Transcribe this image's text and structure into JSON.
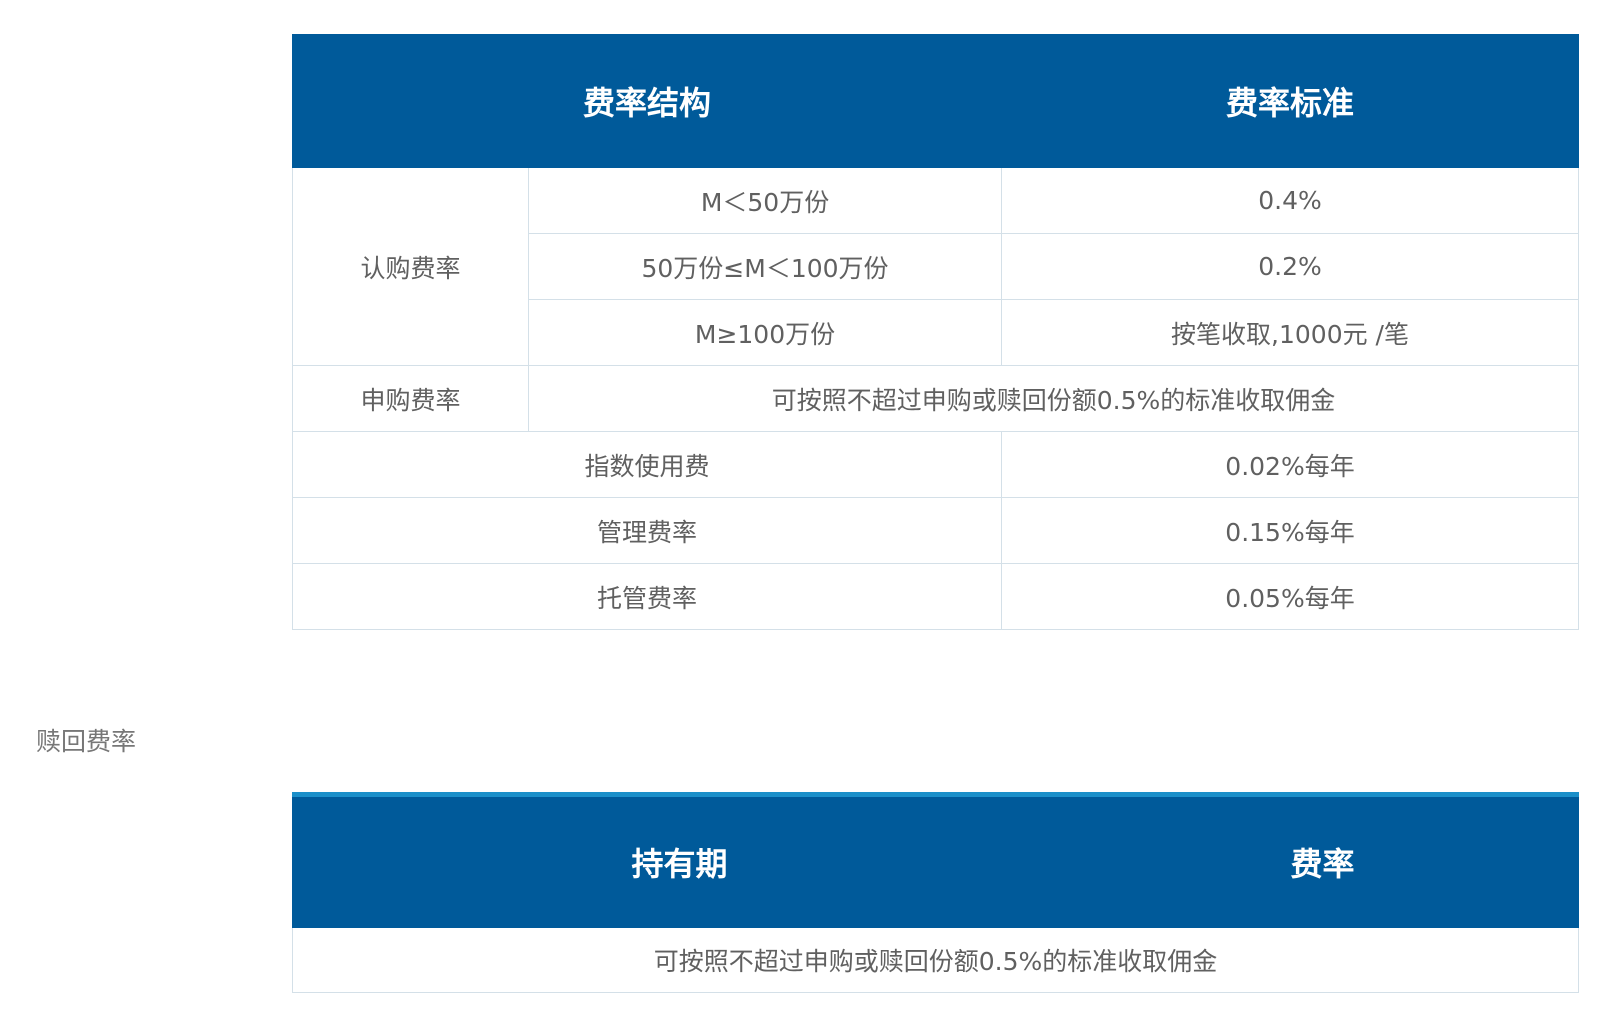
{
  "fee_table": {
    "headers": [
      "费率结构",
      "费率标准"
    ],
    "subscription": {
      "label": "认购费率",
      "tiers": [
        {
          "range": "M＜50万份",
          "rate": "0.4%"
        },
        {
          "range": "50万份≤M＜100万份",
          "rate": "0.2%"
        },
        {
          "range": "M≥100万份",
          "rate": "按笔收取,1000元 /笔"
        }
      ]
    },
    "purchase": {
      "label": "申购费率",
      "value": "可按照不超过申购或赎回份额0.5%的标准收取佣金"
    },
    "rows": [
      {
        "label": "指数使用费",
        "value": "0.02%每年"
      },
      {
        "label": "管理费率",
        "value": "0.15%每年"
      },
      {
        "label": "托管费率",
        "value": "0.05%每年"
      }
    ]
  },
  "redeem_section": {
    "label": "赎回费率"
  },
  "redeem_table": {
    "headers": [
      "持有期",
      "费率"
    ],
    "rows": [
      {
        "value": "可按照不超过申购或赎回份额0.5%的标准收取佣金"
      }
    ]
  },
  "colors": {
    "header_bg": "#005a9a",
    "header_text": "#ffffff",
    "accent_line": "#1b8fc9",
    "border": "#d4e0e8",
    "body_text": "#606060"
  }
}
